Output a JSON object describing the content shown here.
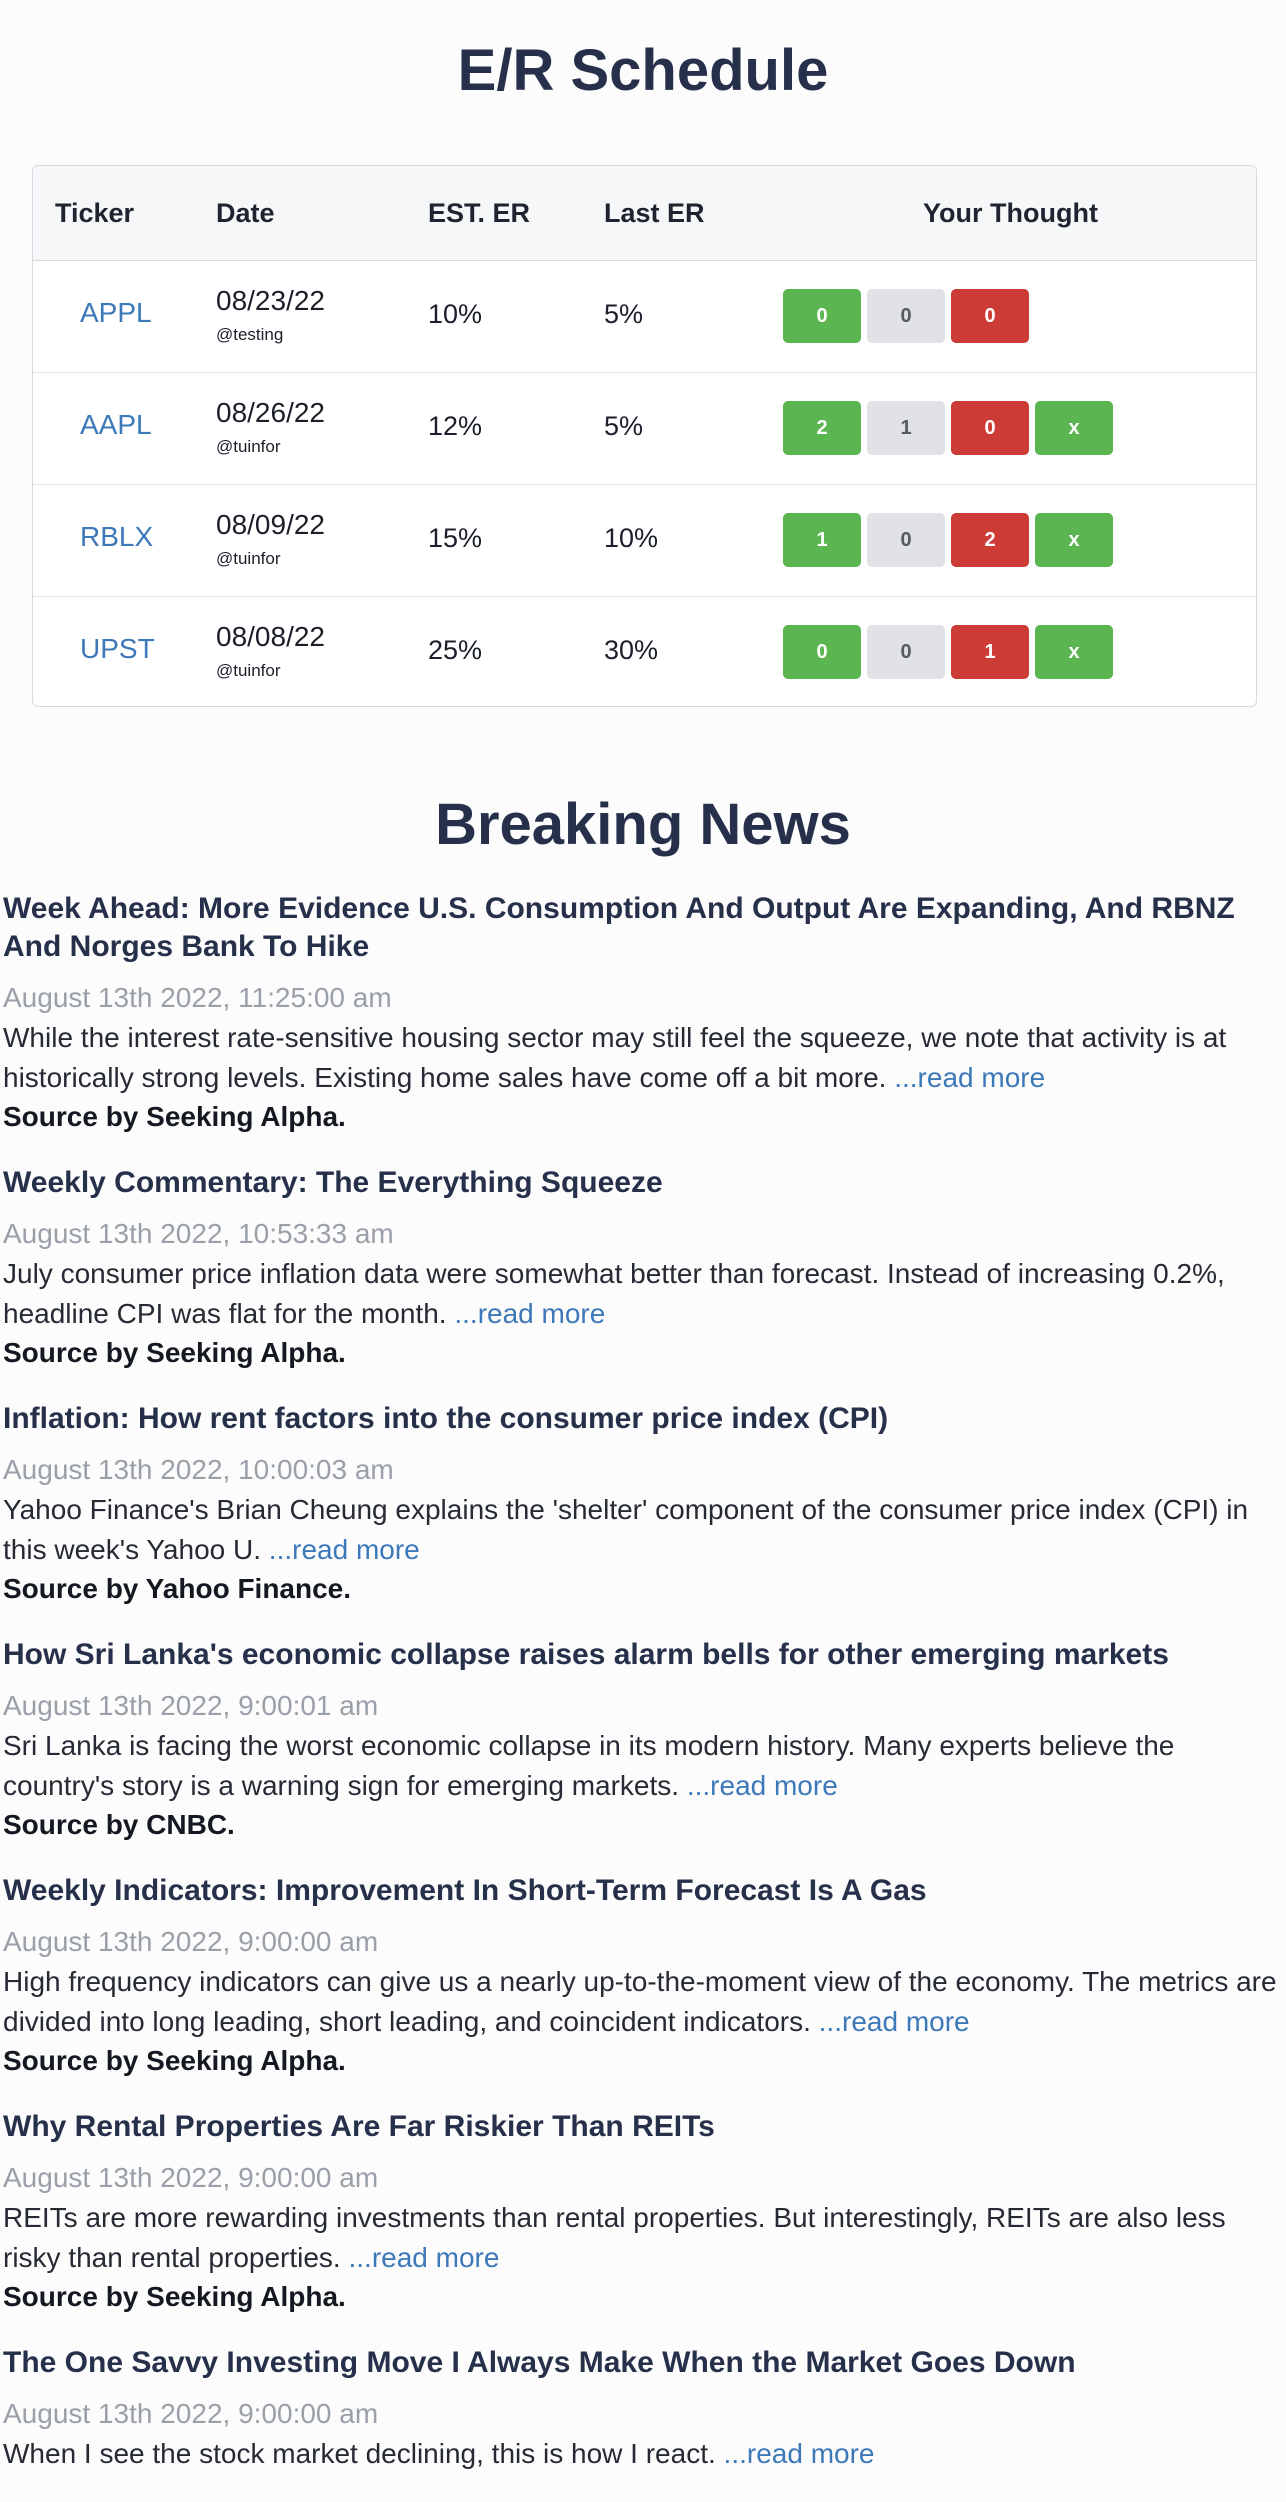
{
  "er_schedule": {
    "title": "E/R Schedule",
    "headers": {
      "ticker": "Ticker",
      "date": "Date",
      "est_er": "EST. ER",
      "last_er": "Last ER",
      "your_thought": "Your Thought"
    },
    "rows": [
      {
        "ticker": "APPL",
        "date": "08/23/22",
        "author": "@testing",
        "est_er": "10%",
        "last_er": "5%",
        "votes": {
          "up": "0",
          "neutral": "0",
          "down": "0"
        },
        "delete_label": null
      },
      {
        "ticker": "AAPL",
        "date": "08/26/22",
        "author": "@tuinfor",
        "est_er": "12%",
        "last_er": "5%",
        "votes": {
          "up": "2",
          "neutral": "1",
          "down": "0"
        },
        "delete_label": "x"
      },
      {
        "ticker": "RBLX",
        "date": "08/09/22",
        "author": "@tuinfor",
        "est_er": "15%",
        "last_er": "10%",
        "votes": {
          "up": "1",
          "neutral": "0",
          "down": "2"
        },
        "delete_label": "x"
      },
      {
        "ticker": "UPST",
        "date": "08/08/22",
        "author": "@tuinfor",
        "est_er": "25%",
        "last_er": "30%",
        "votes": {
          "up": "0",
          "neutral": "0",
          "down": "1"
        },
        "delete_label": "x"
      }
    ]
  },
  "news": {
    "title": "Breaking News",
    "read_more_label": "...read more",
    "items": [
      {
        "headline": "Week Ahead: More Evidence U.S. Consumption And Output Are Expanding, And RBNZ And Norges Bank To Hike",
        "time": "August 13th 2022, 11:25:00 am",
        "summary": "While the interest rate-sensitive housing sector may still feel the squeeze, we note that activity is at historically strong levels. Existing home sales have come off a bit more.",
        "source": "Source by Seeking Alpha."
      },
      {
        "headline": "Weekly Commentary: The Everything Squeeze",
        "time": "August 13th 2022, 10:53:33 am",
        "summary": "July consumer price inflation data were somewhat better than forecast. Instead of increasing 0.2%, headline CPI was flat for the month.",
        "source": "Source by Seeking Alpha."
      },
      {
        "headline": "Inflation: How rent factors into the consumer price index (CPI)",
        "time": "August 13th 2022, 10:00:03 am",
        "summary": "Yahoo Finance's Brian Cheung explains the 'shelter' component of the consumer price index (CPI) in this week's Yahoo U.",
        "source": "Source by Yahoo Finance."
      },
      {
        "headline": "How Sri Lanka's economic collapse raises alarm bells for other emerging markets",
        "time": "August 13th 2022, 9:00:01 am",
        "summary": "Sri Lanka is facing the worst economic collapse in its modern history. Many experts believe the country's story is a warning sign for emerging markets.",
        "source": "Source by CNBC."
      },
      {
        "headline": "Weekly Indicators: Improvement In Short-Term Forecast Is A Gas",
        "time": "August 13th 2022, 9:00:00 am",
        "summary": "High frequency indicators can give us a nearly up-to-the-moment view of the economy. The metrics are divided into long leading, short leading, and coincident indicators.",
        "source": "Source by Seeking Alpha."
      },
      {
        "headline": "Why Rental Properties Are Far Riskier Than REITs",
        "time": "August 13th 2022, 9:00:00 am",
        "summary": "REITs are more rewarding investments than rental properties. But interestingly, REITs are also less risky than rental properties.",
        "source": "Source by Seeking Alpha."
      },
      {
        "headline": "The One Savvy Investing Move I Always Make When the Market Goes Down",
        "time": "August 13th 2022, 9:00:00 am",
        "summary": "When I see the stock market declining, this is how I react.",
        "source": ""
      }
    ]
  }
}
